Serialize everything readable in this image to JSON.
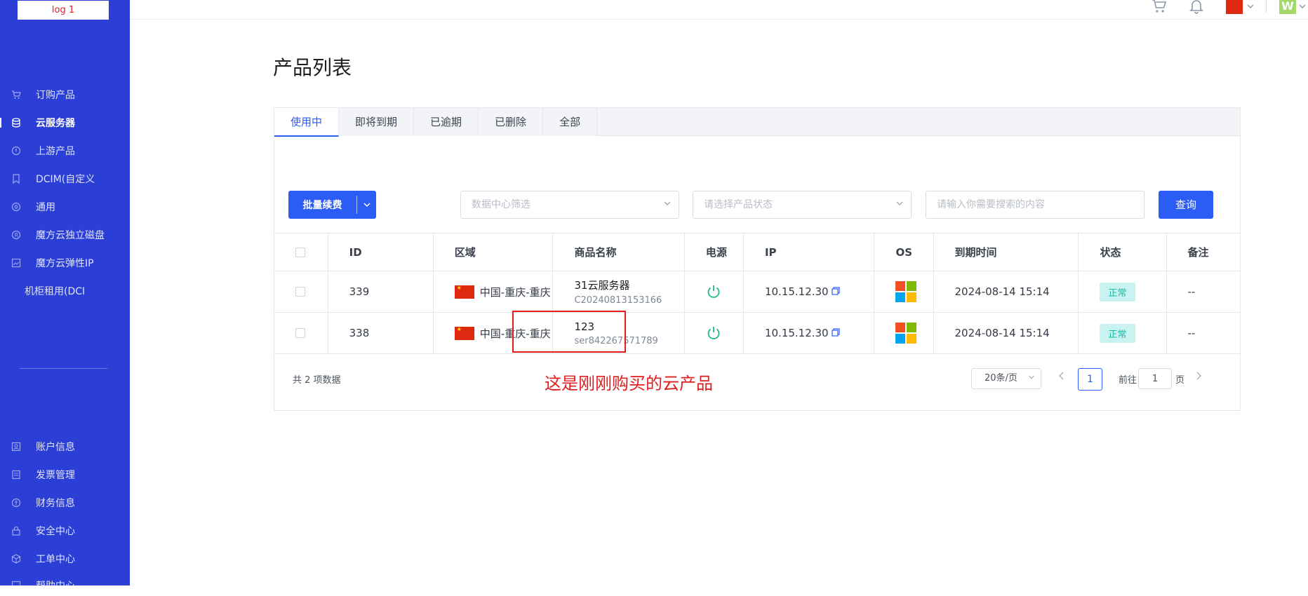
{
  "sidebar": {
    "logo_text": "log 1",
    "items": [
      {
        "label": "订购产品",
        "icon": "cart-icon"
      },
      {
        "label": "云服务器",
        "icon": "database-icon"
      },
      {
        "label": "上游产品",
        "icon": "info-circle-icon"
      },
      {
        "label": "DCIM(自定义",
        "icon": "bookmark-icon"
      },
      {
        "label": "通用",
        "icon": "hand-icon"
      },
      {
        "label": "魔方云独立磁盘",
        "icon": "registered-icon"
      },
      {
        "label": "魔方云弹性IP",
        "icon": "image-icon"
      },
      {
        "label": "机柜租用(DCI",
        "icon": ""
      },
      {
        "label": "账户信息",
        "icon": "user-icon"
      },
      {
        "label": "发票管理",
        "icon": "invoice-icon"
      },
      {
        "label": "财务信息",
        "icon": "money-icon"
      },
      {
        "label": "安全中心",
        "icon": "lock-icon"
      },
      {
        "label": "工单中心",
        "icon": "cube-icon"
      },
      {
        "label": "帮助中心",
        "icon": "help-icon"
      }
    ]
  },
  "topbar": {
    "avatar_letter": "W"
  },
  "page": {
    "title": "产品列表"
  },
  "tabs": [
    "使用中",
    "即将到期",
    "已逾期",
    "已删除",
    "全部"
  ],
  "toolbar": {
    "batch_label": "批量续费",
    "datacenter_placeholder": "数据中心筛选",
    "status_placeholder": "请选择产品状态",
    "search_placeholder": "请输入你需要搜索的内容",
    "query_label": "查询"
  },
  "table": {
    "headers": {
      "id": "ID",
      "region": "区域",
      "name": "商品名称",
      "power": "电源",
      "ip": "IP",
      "os": "OS",
      "expire": "到期时间",
      "status": "状态",
      "note": "备注"
    },
    "rows": [
      {
        "id": "339",
        "region": "中国-重庆-重庆",
        "name": "31云服务器",
        "code": "C20240813153166",
        "ip": "10.15.12.30",
        "expire": "2024-08-14 15:14",
        "status": "正常",
        "note": "--"
      },
      {
        "id": "338",
        "region": "中国-重庆-重庆",
        "name": "123",
        "code": "ser842267571789",
        "ip": "10.15.12.30",
        "expire": "2024-08-14 15:14",
        "status": "正常",
        "note": "--"
      }
    ]
  },
  "annotation": "这是刚刚购买的云产品",
  "pagination": {
    "total": "共 2 项数据",
    "page_size": "20条/页",
    "current": "1",
    "goto_label": "前往",
    "goto_value": "1",
    "page_suffix": "页"
  },
  "colors": {
    "sidebar_bg": "#2b3ed6",
    "primary": "#2b5cf6",
    "annotation_red": "#e21d1d",
    "status_ok_bg": "#c9f3f0",
    "power_on": "#20b78a"
  }
}
